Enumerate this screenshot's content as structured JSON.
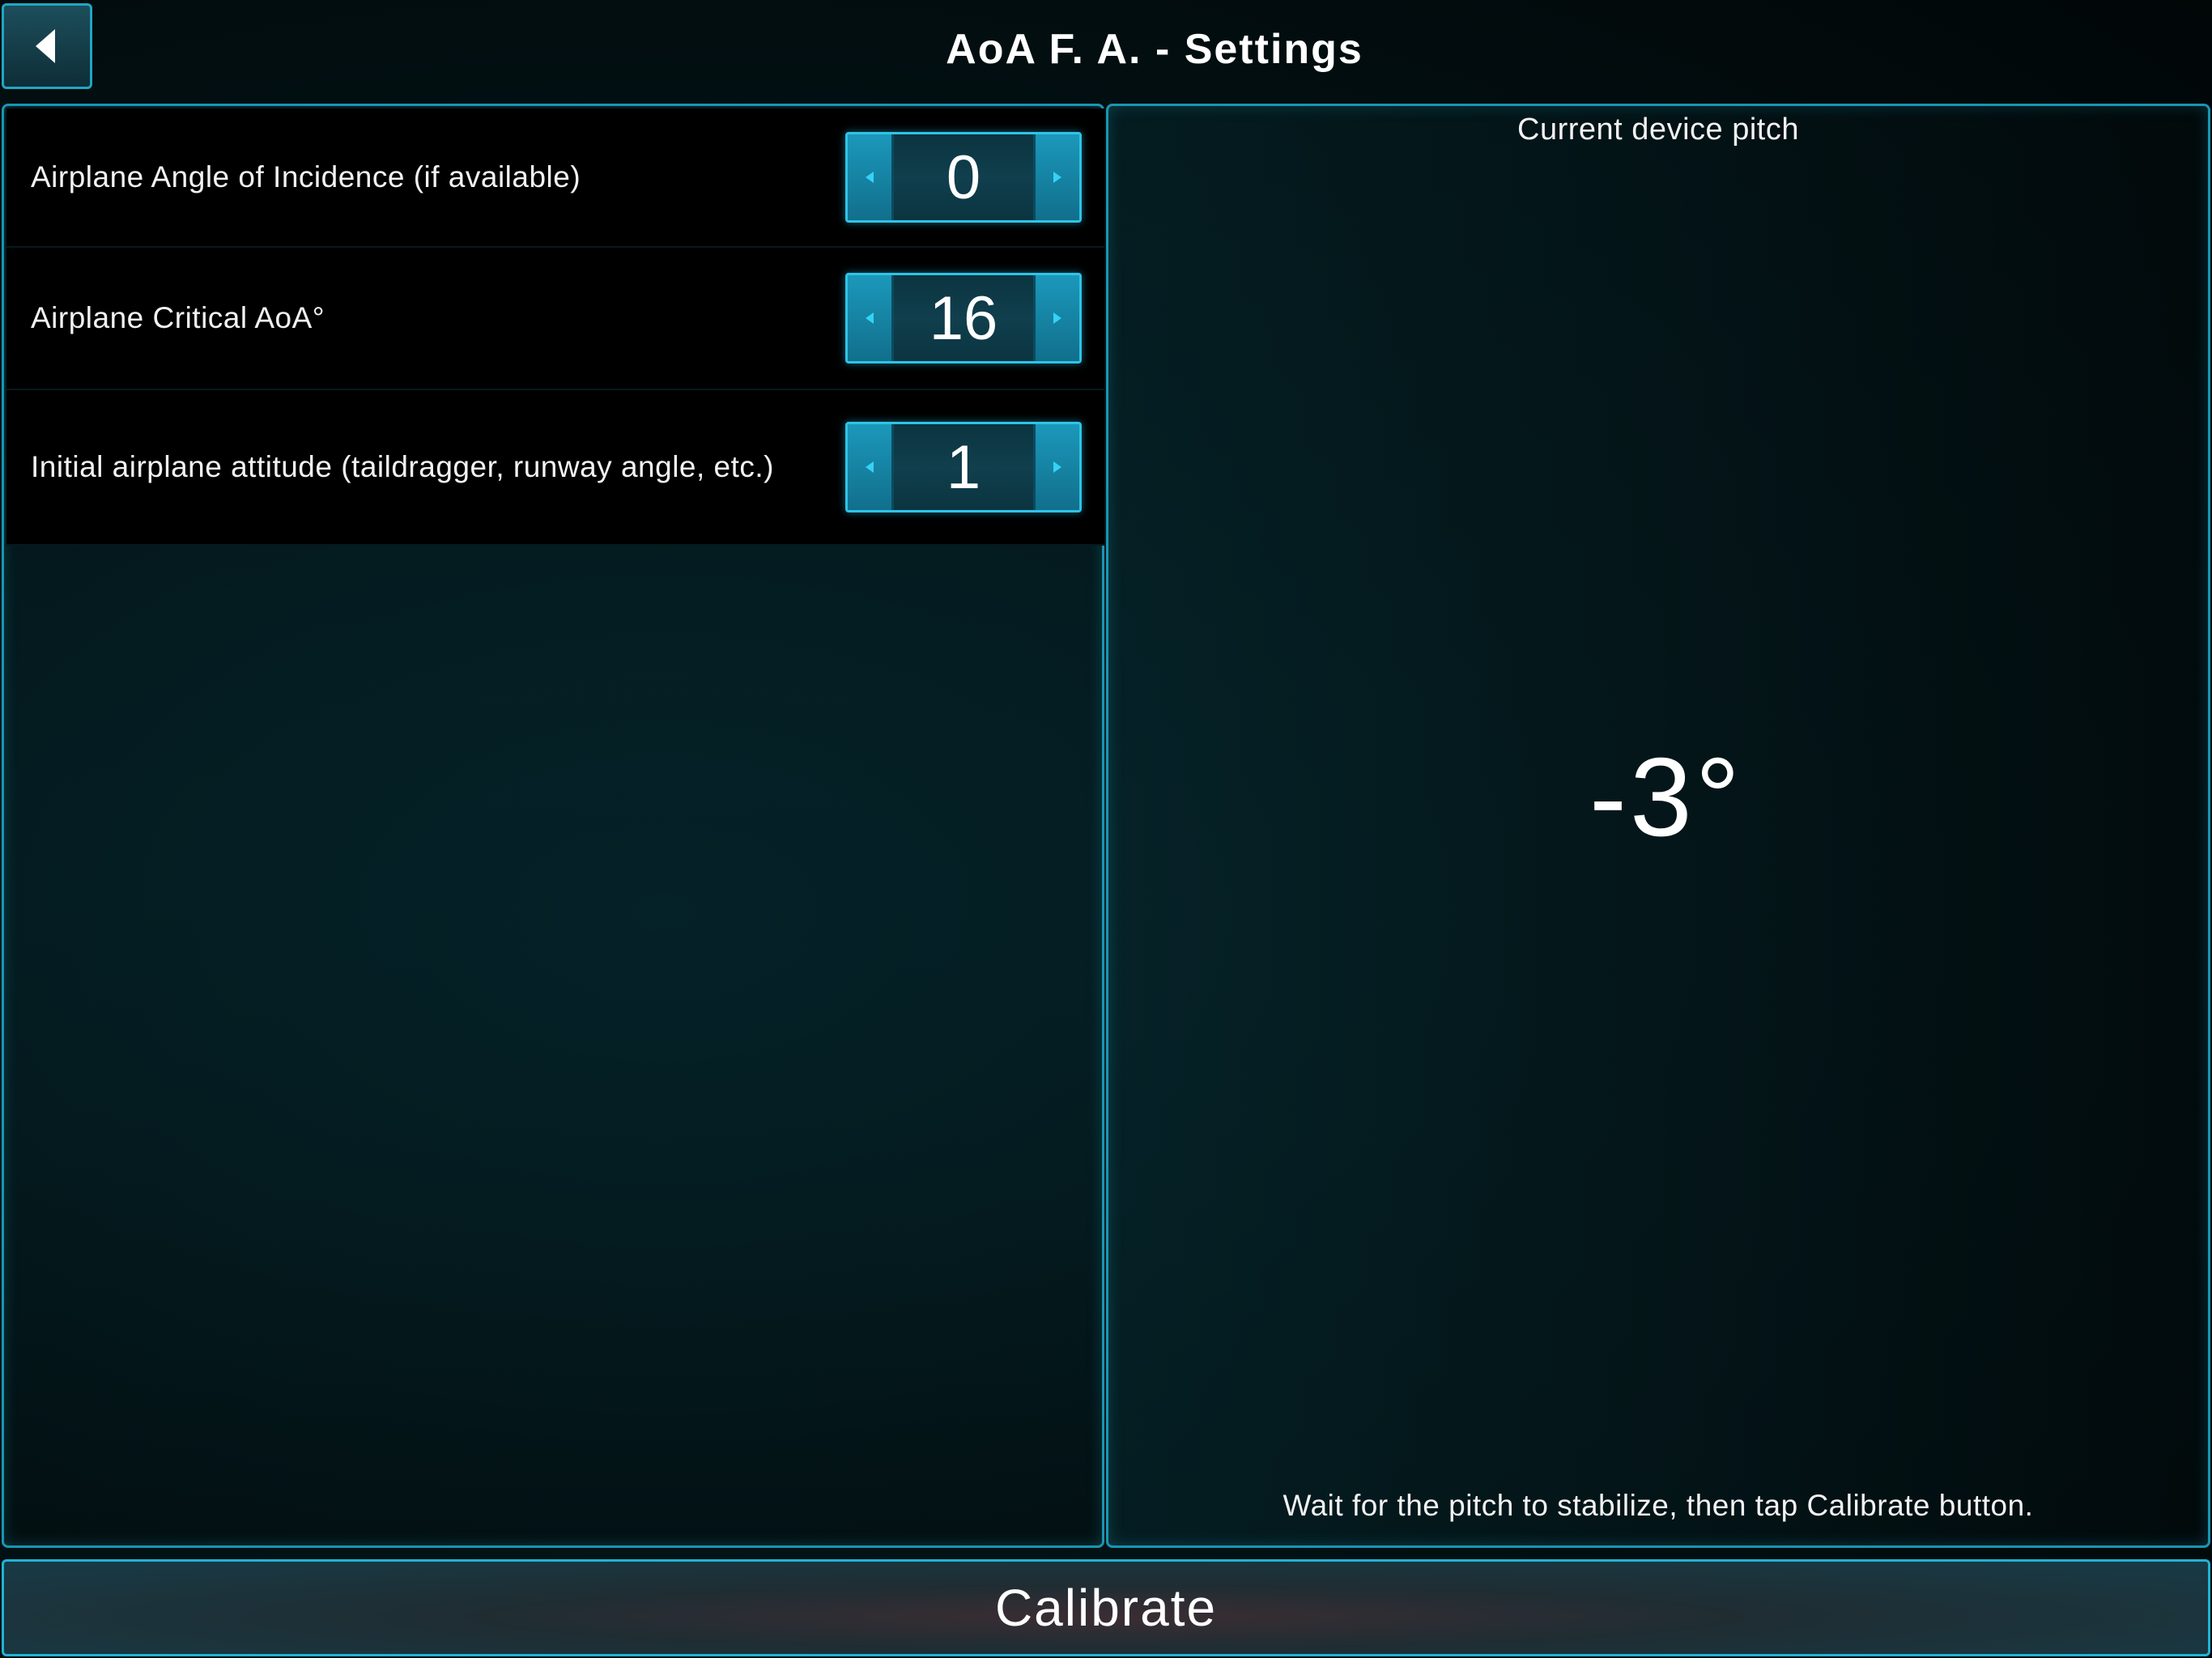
{
  "header": {
    "title": "AoA F. A. - Settings",
    "back_icon": "chevron-left-icon"
  },
  "settings": [
    {
      "label": "Airplane Angle of Incidence (if available)",
      "value": "0",
      "decrement_icon": "arrow-left-icon",
      "increment_icon": "arrow-right-icon"
    },
    {
      "label": "Airplane Critical AoA°",
      "value": "16",
      "decrement_icon": "arrow-left-icon",
      "increment_icon": "arrow-right-icon"
    },
    {
      "label": "Initial airplane attitude (taildragger, runway angle, etc.)",
      "value": "1",
      "decrement_icon": "arrow-left-icon",
      "increment_icon": "arrow-right-icon"
    }
  ],
  "pitch": {
    "title": "Current device pitch",
    "value": "-3°",
    "hint": "Wait for the pitch to stabilize, then tap Calibrate button."
  },
  "footer": {
    "calibrate_label": "Calibrate"
  },
  "colors": {
    "accent": "#1fa6c4",
    "stepper_fill": "#1a8fb0",
    "background": "#031417",
    "text": "#ffffff"
  }
}
